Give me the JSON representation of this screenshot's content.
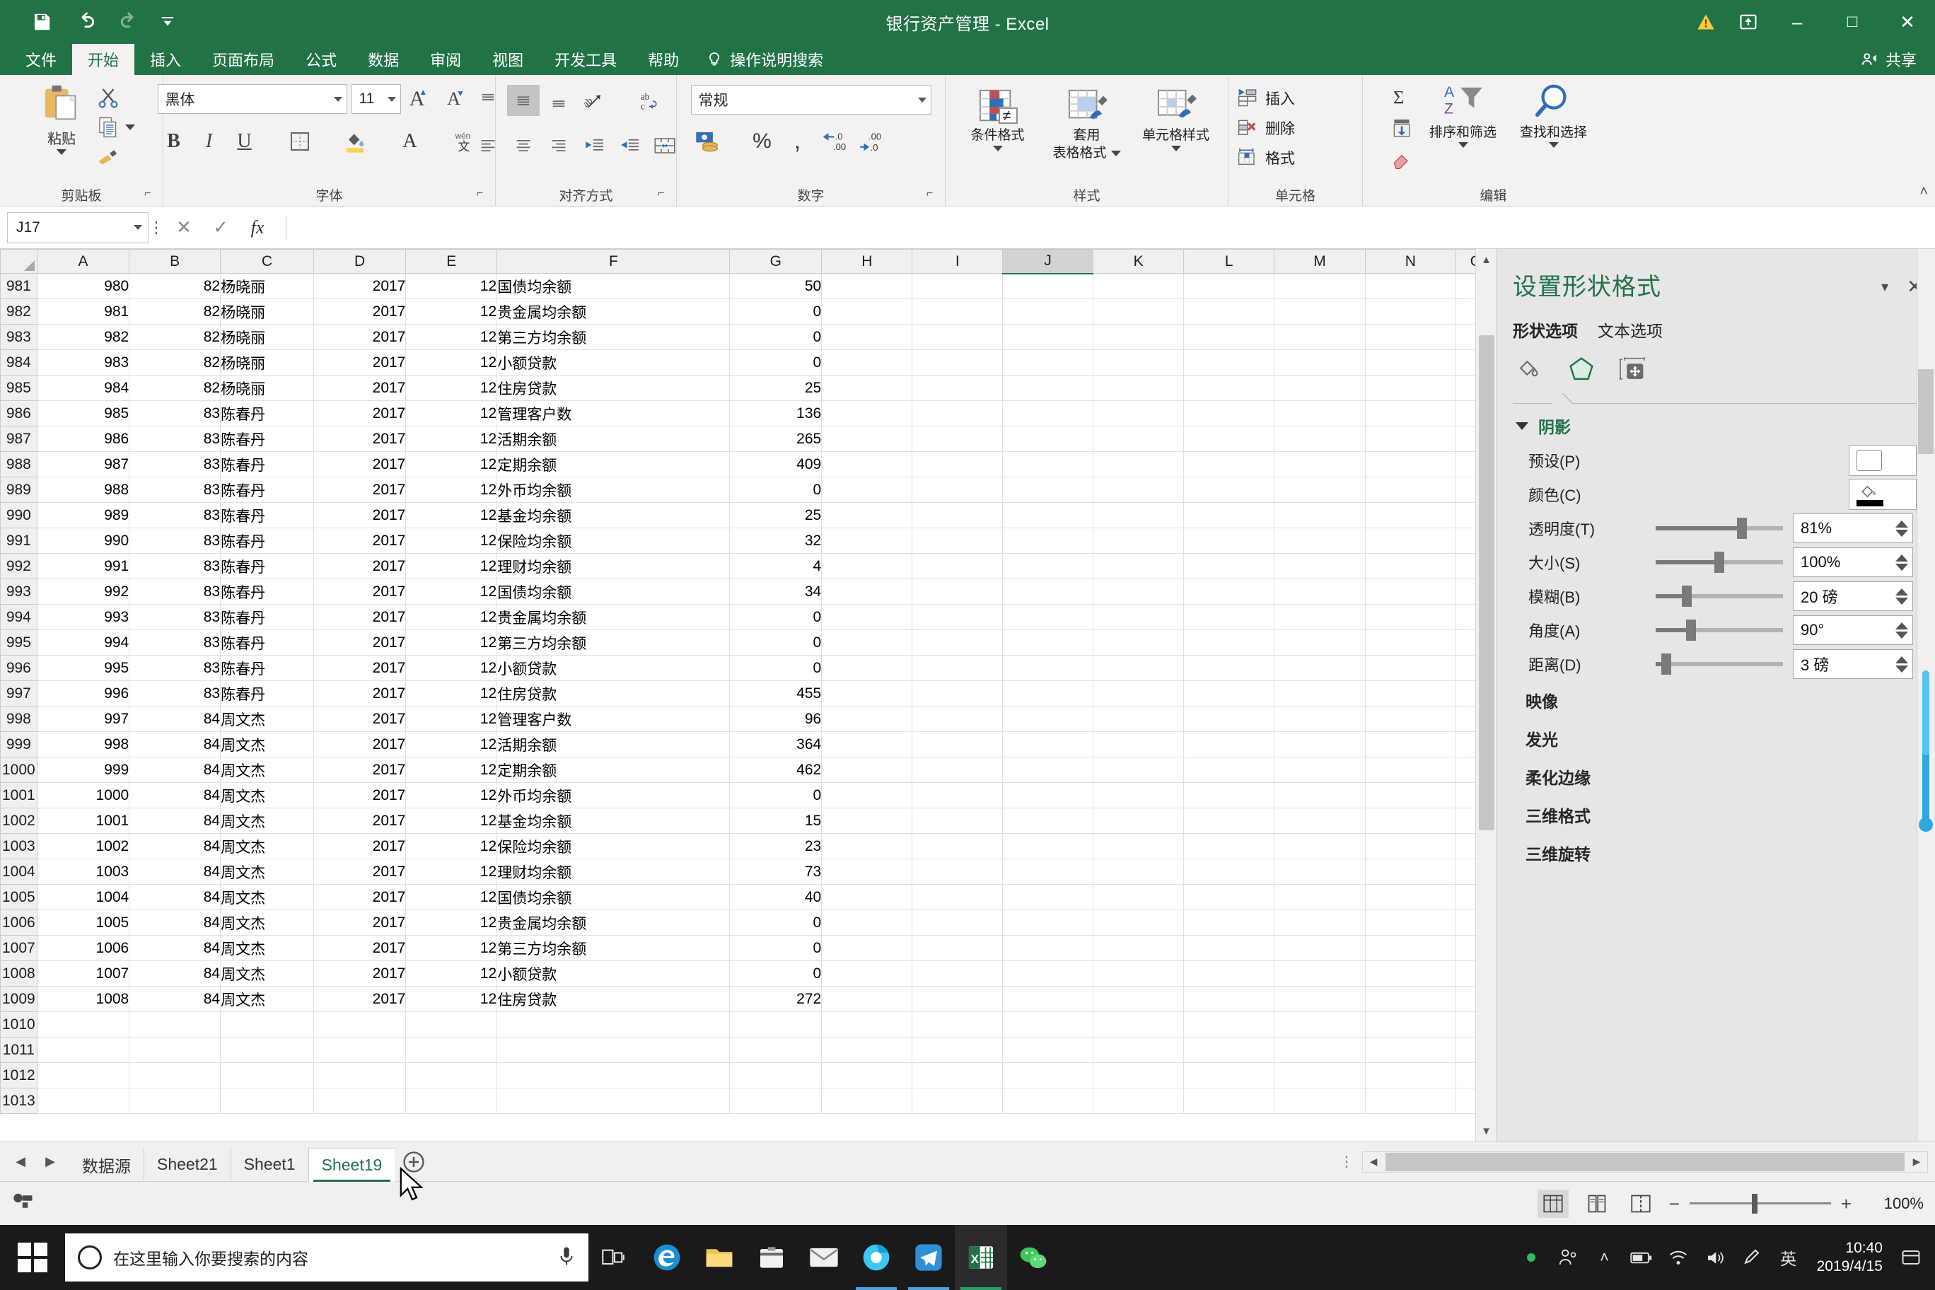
{
  "titlebar": {
    "document_title": "银行资产管理  -  Excel",
    "qat": [
      {
        "name": "save",
        "icon": "save-icon"
      },
      {
        "name": "undo",
        "icon": "undo-icon"
      },
      {
        "name": "redo",
        "icon": "redo-icon"
      },
      {
        "name": "customize",
        "icon": "chevron-down-icon"
      }
    ],
    "warning_icon": "warning-triangle-icon",
    "restore_icon": "restore-window-icon",
    "minimize": "–",
    "maximize": "□",
    "close": "✕"
  },
  "ribbon": {
    "tabs": [
      "文件",
      "开始",
      "插入",
      "页面布局",
      "公式",
      "数据",
      "审阅",
      "视图",
      "开发工具",
      "帮助"
    ],
    "active_tab": "开始",
    "tell_me": "操作说明搜索",
    "share": "共享",
    "groups": {
      "clipboard": {
        "label": "剪贴板",
        "paste": "粘贴",
        "cut": "剪切",
        "copy": "复制",
        "format_painter": "格式刷"
      },
      "font": {
        "label": "字体",
        "font_name": "黑体",
        "font_size": "11",
        "grow": "A",
        "shrink": "A",
        "bold": "B",
        "italic": "I",
        "underline": "U",
        "borders": "边框",
        "fill_color": "填充颜色",
        "font_color": "A",
        "phonetic": "wén 文"
      },
      "alignment": {
        "label": "对齐方式",
        "orientation": "方向",
        "wrap_text": "自动换行",
        "merge": "合并后居中"
      },
      "number": {
        "label": "数字",
        "format": "常规",
        "accounting": "会计数字格式",
        "percent": "%",
        "comma": ",",
        "dec_inc": ".0 .00",
        "dec_dec": ".00 .0"
      },
      "styles": {
        "label": "样式",
        "conditional": "条件格式",
        "table_style_l1": "套用",
        "table_style_l2": "表格格式",
        "cell_style": "单元格样式"
      },
      "cells": {
        "label": "单元格",
        "insert": "插入",
        "delete": "删除",
        "format": "格式"
      },
      "editing": {
        "label": "编辑",
        "autosum": "Σ",
        "fill": "填充",
        "clear": "清除",
        "sort_filter": "排序和筛选",
        "find_select": "查找和选择"
      }
    }
  },
  "formulabar": {
    "name_box": "J17",
    "cancel_icon": "cancel-icon",
    "confirm_icon": "confirm-icon",
    "fx_icon": "fx",
    "formula_value": "",
    "expand_icon": "chevron-down-icon"
  },
  "grid": {
    "columns": [
      "A",
      "B",
      "C",
      "D",
      "E",
      "F",
      "G",
      "H",
      "I",
      "J",
      "K",
      "L",
      "M",
      "N",
      "O"
    ],
    "selected_column": "J",
    "selected_cell": "J17",
    "rows": [
      {
        "h": "981",
        "a": "980",
        "b": "82",
        "c": "杨晓丽",
        "d": "2017",
        "e": "12",
        "f": "国债均余额",
        "g": "50"
      },
      {
        "h": "982",
        "a": "981",
        "b": "82",
        "c": "杨晓丽",
        "d": "2017",
        "e": "12",
        "f": "贵金属均余额",
        "g": "0"
      },
      {
        "h": "983",
        "a": "982",
        "b": "82",
        "c": "杨晓丽",
        "d": "2017",
        "e": "12",
        "f": "第三方均余额",
        "g": "0"
      },
      {
        "h": "984",
        "a": "983",
        "b": "82",
        "c": "杨晓丽",
        "d": "2017",
        "e": "12",
        "f": "小额贷款",
        "g": "0"
      },
      {
        "h": "985",
        "a": "984",
        "b": "82",
        "c": "杨晓丽",
        "d": "2017",
        "e": "12",
        "f": "住房贷款",
        "g": "25"
      },
      {
        "h": "986",
        "a": "985",
        "b": "83",
        "c": "陈春丹",
        "d": "2017",
        "e": "12",
        "f": "管理客户数",
        "g": "136"
      },
      {
        "h": "987",
        "a": "986",
        "b": "83",
        "c": "陈春丹",
        "d": "2017",
        "e": "12",
        "f": "活期余额",
        "g": "265"
      },
      {
        "h": "988",
        "a": "987",
        "b": "83",
        "c": "陈春丹",
        "d": "2017",
        "e": "12",
        "f": "定期余额",
        "g": "409"
      },
      {
        "h": "989",
        "a": "988",
        "b": "83",
        "c": "陈春丹",
        "d": "2017",
        "e": "12",
        "f": "外币均余额",
        "g": "0"
      },
      {
        "h": "990",
        "a": "989",
        "b": "83",
        "c": "陈春丹",
        "d": "2017",
        "e": "12",
        "f": "基金均余额",
        "g": "25"
      },
      {
        "h": "991",
        "a": "990",
        "b": "83",
        "c": "陈春丹",
        "d": "2017",
        "e": "12",
        "f": "保险均余额",
        "g": "32"
      },
      {
        "h": "992",
        "a": "991",
        "b": "83",
        "c": "陈春丹",
        "d": "2017",
        "e": "12",
        "f": "理财均余额",
        "g": "4"
      },
      {
        "h": "993",
        "a": "992",
        "b": "83",
        "c": "陈春丹",
        "d": "2017",
        "e": "12",
        "f": "国债均余额",
        "g": "34"
      },
      {
        "h": "994",
        "a": "993",
        "b": "83",
        "c": "陈春丹",
        "d": "2017",
        "e": "12",
        "f": "贵金属均余额",
        "g": "0"
      },
      {
        "h": "995",
        "a": "994",
        "b": "83",
        "c": "陈春丹",
        "d": "2017",
        "e": "12",
        "f": "第三方均余额",
        "g": "0"
      },
      {
        "h": "996",
        "a": "995",
        "b": "83",
        "c": "陈春丹",
        "d": "2017",
        "e": "12",
        "f": "小额贷款",
        "g": "0"
      },
      {
        "h": "997",
        "a": "996",
        "b": "83",
        "c": "陈春丹",
        "d": "2017",
        "e": "12",
        "f": "住房贷款",
        "g": "455"
      },
      {
        "h": "998",
        "a": "997",
        "b": "84",
        "c": "周文杰",
        "d": "2017",
        "e": "12",
        "f": "管理客户数",
        "g": "96"
      },
      {
        "h": "999",
        "a": "998",
        "b": "84",
        "c": "周文杰",
        "d": "2017",
        "e": "12",
        "f": "活期余额",
        "g": "364"
      },
      {
        "h": "1000",
        "a": "999",
        "b": "84",
        "c": "周文杰",
        "d": "2017",
        "e": "12",
        "f": "定期余额",
        "g": "462"
      },
      {
        "h": "1001",
        "a": "1000",
        "b": "84",
        "c": "周文杰",
        "d": "2017",
        "e": "12",
        "f": "外币均余额",
        "g": "0"
      },
      {
        "h": "1002",
        "a": "1001",
        "b": "84",
        "c": "周文杰",
        "d": "2017",
        "e": "12",
        "f": "基金均余额",
        "g": "15"
      },
      {
        "h": "1003",
        "a": "1002",
        "b": "84",
        "c": "周文杰",
        "d": "2017",
        "e": "12",
        "f": "保险均余额",
        "g": "23"
      },
      {
        "h": "1004",
        "a": "1003",
        "b": "84",
        "c": "周文杰",
        "d": "2017",
        "e": "12",
        "f": "理财均余额",
        "g": "73"
      },
      {
        "h": "1005",
        "a": "1004",
        "b": "84",
        "c": "周文杰",
        "d": "2017",
        "e": "12",
        "f": "国债均余额",
        "g": "40"
      },
      {
        "h": "1006",
        "a": "1005",
        "b": "84",
        "c": "周文杰",
        "d": "2017",
        "e": "12",
        "f": "贵金属均余额",
        "g": "0"
      },
      {
        "h": "1007",
        "a": "1006",
        "b": "84",
        "c": "周文杰",
        "d": "2017",
        "e": "12",
        "f": "第三方均余额",
        "g": "0"
      },
      {
        "h": "1008",
        "a": "1007",
        "b": "84",
        "c": "周文杰",
        "d": "2017",
        "e": "12",
        "f": "小额贷款",
        "g": "0"
      },
      {
        "h": "1009",
        "a": "1008",
        "b": "84",
        "c": "周文杰",
        "d": "2017",
        "e": "12",
        "f": "住房贷款",
        "g": "272"
      },
      {
        "h": "1010",
        "a": "",
        "b": "",
        "c": "",
        "d": "",
        "e": "",
        "f": "",
        "g": ""
      },
      {
        "h": "1011",
        "a": "",
        "b": "",
        "c": "",
        "d": "",
        "e": "",
        "f": "",
        "g": ""
      },
      {
        "h": "1012",
        "a": "",
        "b": "",
        "c": "",
        "d": "",
        "e": "",
        "f": "",
        "g": ""
      },
      {
        "h": "1013",
        "a": "",
        "b": "",
        "c": "",
        "d": "",
        "e": "",
        "f": "",
        "g": ""
      }
    ]
  },
  "taskpane": {
    "title": "设置形状格式",
    "tabs": [
      {
        "label": "形状选项",
        "active": true
      },
      {
        "label": "文本选项",
        "active": false
      }
    ],
    "icon_tabs": [
      {
        "name": "fill-line-icon",
        "active": false
      },
      {
        "name": "effects-pentagon-icon",
        "active": true
      },
      {
        "name": "size-properties-icon",
        "active": false
      }
    ],
    "sections": [
      {
        "label": "阴影",
        "expanded": true
      },
      {
        "label": "映像",
        "expanded": false
      },
      {
        "label": "发光",
        "expanded": false
      },
      {
        "label": "柔化边缘",
        "expanded": false
      },
      {
        "label": "三维格式",
        "expanded": false
      },
      {
        "label": "三维旋转",
        "expanded": false
      }
    ],
    "shadow": {
      "preset_label": "预设(P)",
      "color_label": "颜色(C)",
      "properties": [
        {
          "label": "透明度(T)",
          "value": "81%",
          "fill": 0.72
        },
        {
          "label": "大小(S)",
          "value": "100%",
          "fill": 0.52
        },
        {
          "label": "模糊(B)",
          "value": "20 磅",
          "fill": 0.23
        },
        {
          "label": "角度(A)",
          "value": "90°",
          "fill": 0.27
        },
        {
          "label": "距离(D)",
          "value": "3 磅",
          "fill": 0.05
        }
      ]
    },
    "close_icon": "close-icon",
    "menu_icon": "chevron-down-icon"
  },
  "sheettabs": {
    "tabs": [
      "数据源",
      "Sheet21",
      "Sheet1",
      "Sheet19"
    ],
    "active": "Sheet19",
    "add_label": "+",
    "prev_icon": "chevron-left-icon",
    "next_icon": "chevron-right-icon"
  },
  "statusbar": {
    "accessibility_icon": "accessibility-icon",
    "views": [
      {
        "name": "normal-view",
        "selected": true
      },
      {
        "name": "page-layout-view",
        "selected": false
      },
      {
        "name": "page-break-view",
        "selected": false
      }
    ],
    "zoom_out": "−",
    "zoom_in": "+",
    "zoom_level": "100%"
  },
  "taskbar": {
    "start_icon": "windows-start-icon",
    "search_placeholder": "在这里输入你要搜索的内容",
    "mic_icon": "microphone-icon",
    "task_view_icon": "task-view-icon",
    "apps": [
      {
        "name": "edge-icon"
      },
      {
        "name": "file-explorer-icon"
      },
      {
        "name": "store-icon"
      },
      {
        "name": "mail-icon"
      },
      {
        "name": "browser-icon"
      },
      {
        "name": "telegram-icon"
      },
      {
        "name": "excel-icon"
      },
      {
        "name": "wechat-icon"
      }
    ],
    "tray": [
      {
        "name": "dot-icon"
      },
      {
        "name": "people-icon"
      },
      {
        "name": "chevron-up-icon"
      },
      {
        "name": "battery-icon"
      },
      {
        "name": "network-icon"
      },
      {
        "name": "volume-icon"
      },
      {
        "name": "pen-icon"
      }
    ],
    "ime": "英",
    "time": "10:40",
    "date": "2019/4/15",
    "notification_icon": "notification-icon"
  },
  "colors": {
    "excel_green": "#217346",
    "ribbon_bg": "#f3f2f1",
    "taskpane_bg": "#e6e6e6",
    "accent_blue": "#4472c4"
  }
}
